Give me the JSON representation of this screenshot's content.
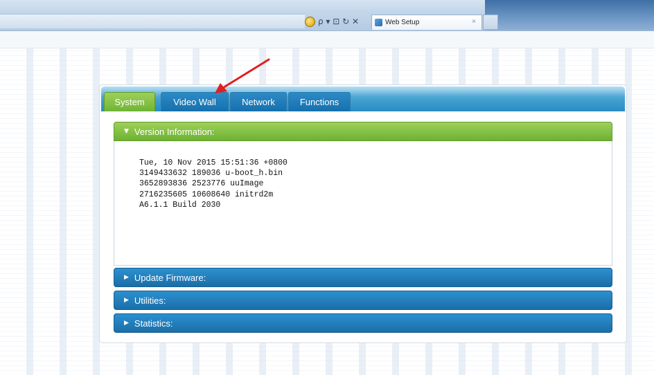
{
  "browser": {
    "tab_title": "Web Setup",
    "tab_close": "×",
    "address_icons": "ρ ▾ ⊡ ↻ ✕"
  },
  "tabs": [
    {
      "label": "System",
      "active": true
    },
    {
      "label": "Video Wall",
      "active": false
    },
    {
      "label": "Network",
      "active": false
    },
    {
      "label": "Functions",
      "active": false
    }
  ],
  "sections": {
    "version": {
      "title": "Version Information:",
      "expanded": true,
      "lines": [
        "Tue, 10 Nov 2015 15:51:36 +0800",
        "3149433632 189036 u-boot_h.bin",
        "3652893836 2523776 uuImage",
        "2716235605 10608640 initrd2m",
        "A6.1.1 Build 2030"
      ]
    },
    "update_firmware": {
      "title": "Update Firmware:",
      "expanded": false
    },
    "utilities": {
      "title": "Utilities:",
      "expanded": false
    },
    "statistics": {
      "title": "Statistics:",
      "expanded": false
    }
  },
  "colors": {
    "active_tab": "#6fb534",
    "tab_blue": "#1670ad",
    "annotation_arrow": "#e02020"
  }
}
